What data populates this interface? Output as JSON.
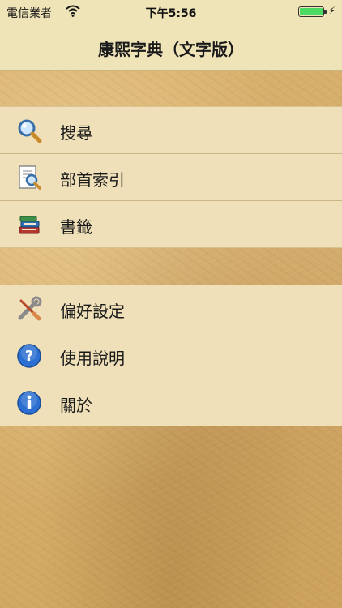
{
  "status": {
    "carrier": "電信業者",
    "time": "下午5:56",
    "battery_level": 1.0
  },
  "nav": {
    "title": "康熙字典（文字版）"
  },
  "menu_groups": [
    {
      "items": [
        {
          "label": "搜尋",
          "icon": "magnifier-icon"
        },
        {
          "label": "部首索引",
          "icon": "index-document-icon"
        },
        {
          "label": "書籤",
          "icon": "bookmark-books-icon"
        }
      ]
    },
    {
      "items": [
        {
          "label": "偏好設定",
          "icon": "tools-icon"
        },
        {
          "label": "使用說明",
          "icon": "help-icon"
        },
        {
          "label": "關於",
          "icon": "info-icon"
        }
      ]
    }
  ],
  "colors": {
    "background": "#d7ae6a",
    "bar": "#efe3b8",
    "row": "#efe0b9",
    "accent_blue": "#2a6fd1"
  }
}
